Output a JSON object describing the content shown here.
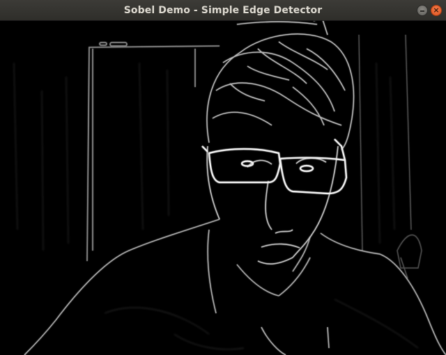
{
  "window": {
    "title": "Sobel Demo - Simple Edge Detector",
    "close_glyph": "×"
  },
  "icons": {
    "minimize": "minimize-icon",
    "close": "close-icon"
  },
  "colors": {
    "titlebar": "#3c3b37",
    "close_button": "#e95420",
    "edge_stroke": "#e6e6e6",
    "background": "#000000"
  }
}
